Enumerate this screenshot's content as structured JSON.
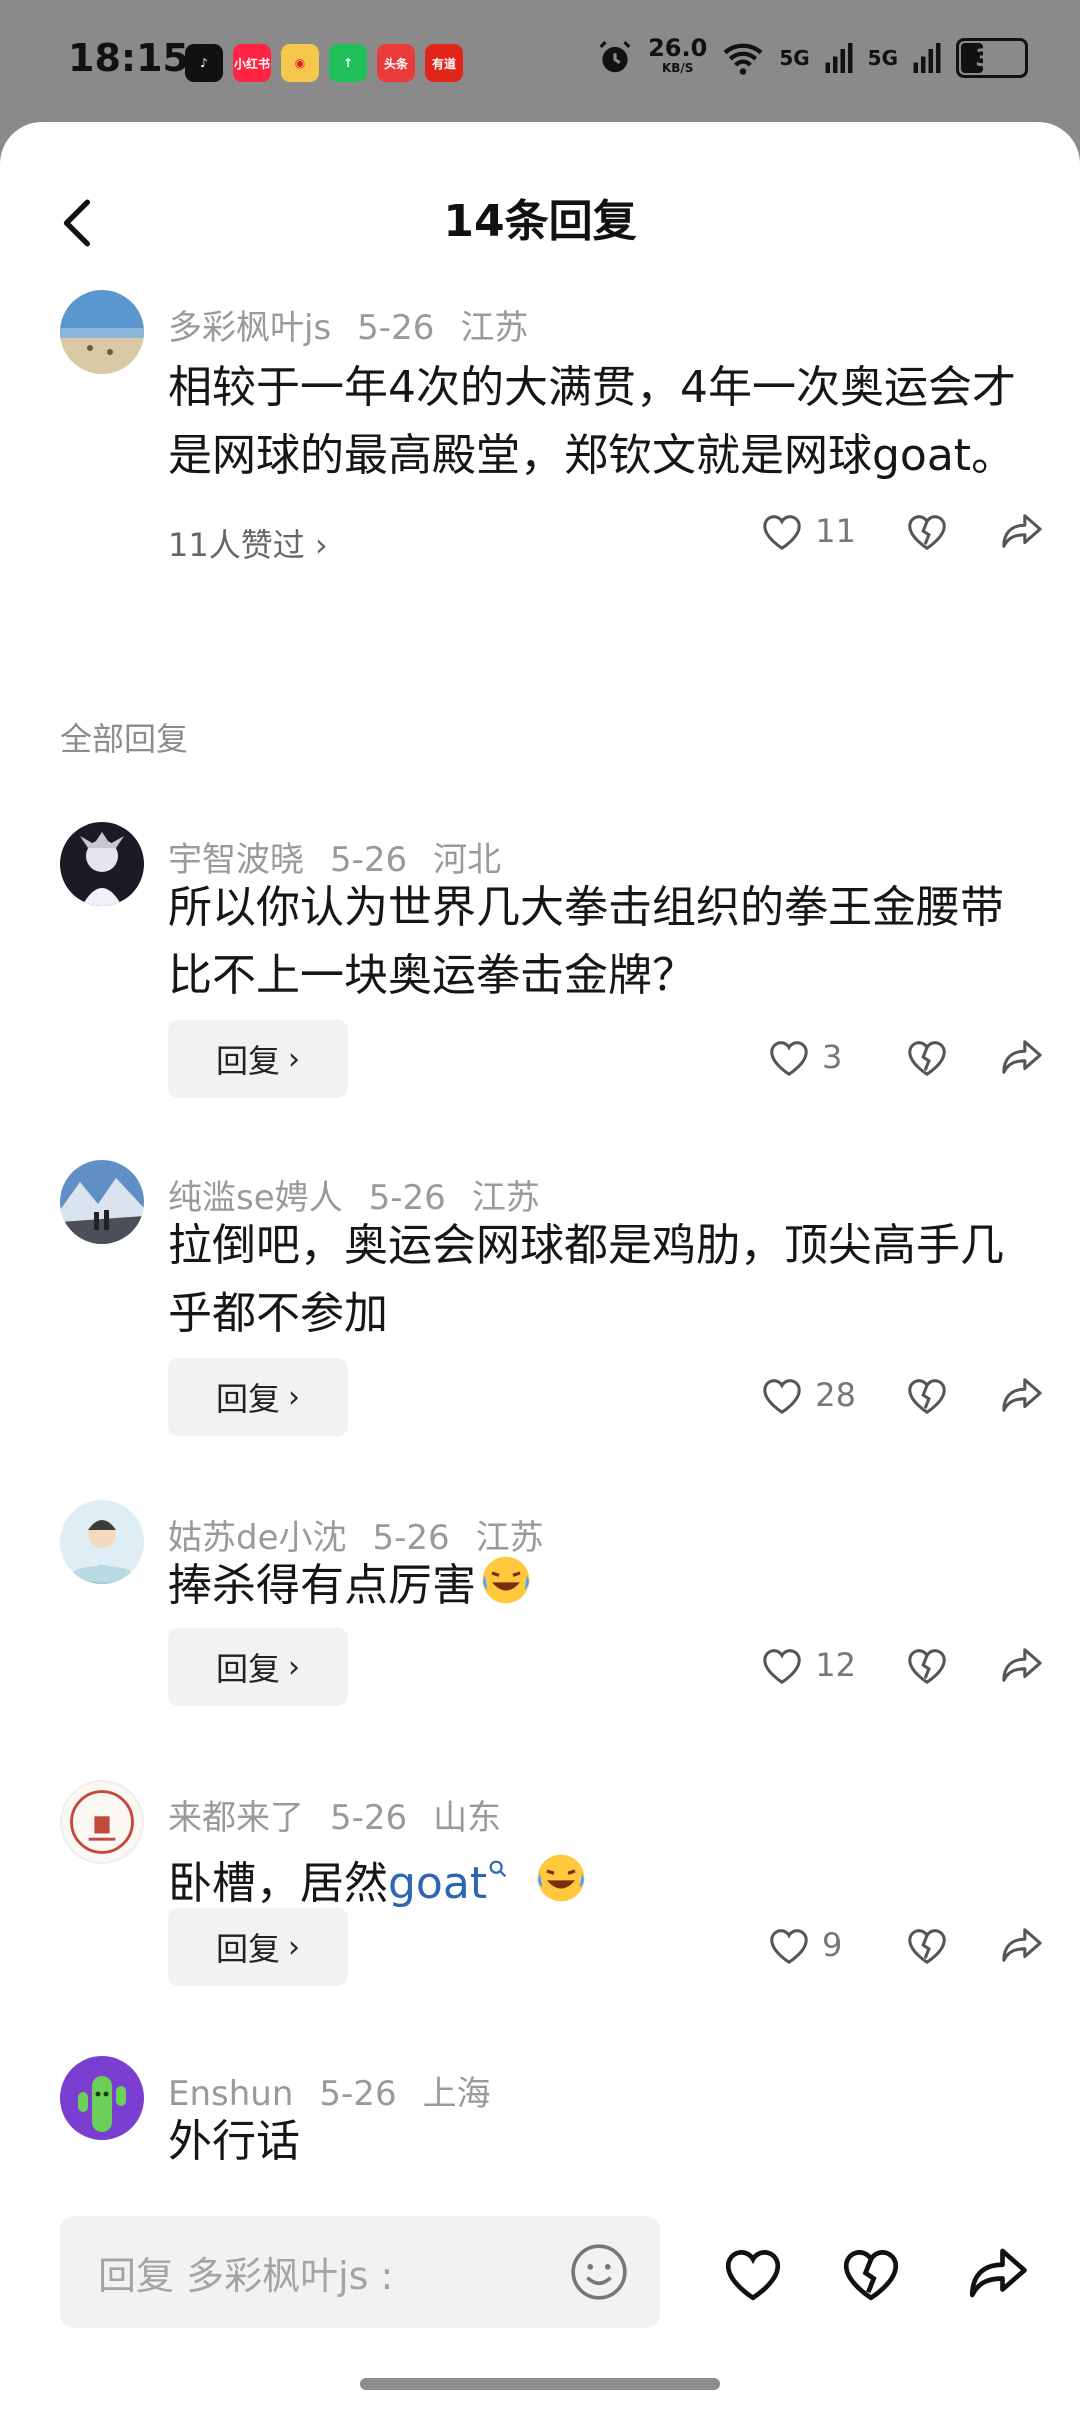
{
  "status": {
    "time": "18:15",
    "net_speed": "26.0",
    "net_unit": "KB/S",
    "sig1": "5G",
    "sig2": "5G",
    "battery": "34",
    "battery_level": 0.34,
    "apps": [
      {
        "label": "",
        "color": "#111111"
      },
      {
        "label": "小红书",
        "color": "#ff2442"
      },
      {
        "label": "",
        "color": "#e6162d"
      },
      {
        "label": "",
        "color": "#1fbf5a"
      },
      {
        "label": "头条",
        "color": "#e93b3b"
      },
      {
        "label": "有道",
        "color": "#e1251b"
      }
    ]
  },
  "header": {
    "title": "14条回复"
  },
  "main_comment": {
    "user": "多彩枫叶js",
    "date": "5-26",
    "location": "江苏",
    "text": "相较于一年4次的大满贯，4年一次奥运会才是网球的最高殿堂，郑钦文就是网球goat。",
    "likers": "11人赞过 ›",
    "likes": "11"
  },
  "section_label": "全部回复",
  "reply_label": "回复",
  "replies": [
    {
      "user": "宇智波晓",
      "date": "5-26",
      "location": "河北",
      "text": "所以你认为世界几大拳击组织的拳王金腰带比不上一块奥运拳击金牌？",
      "likes": "3"
    },
    {
      "user": "纯滥se娉人",
      "date": "5-26",
      "location": "江苏",
      "text": "拉倒吧，奥运会网球都是鸡肋，顶尖高手几乎都不参加",
      "likes": "28"
    },
    {
      "user": "姑苏de小沈",
      "date": "5-26",
      "location": "江苏",
      "text": "捧杀得有点厉害",
      "likes": "12"
    },
    {
      "user": "来都来了",
      "date": "5-26",
      "location": "山东",
      "text_prefix": "卧槽，居然",
      "hashtag": "goat",
      "likes": "9"
    },
    {
      "user": "Enshun",
      "date": "5-26",
      "location": "上海",
      "text": "外行话"
    }
  ],
  "input": {
    "placeholder": "回复 多彩枫叶js :"
  }
}
